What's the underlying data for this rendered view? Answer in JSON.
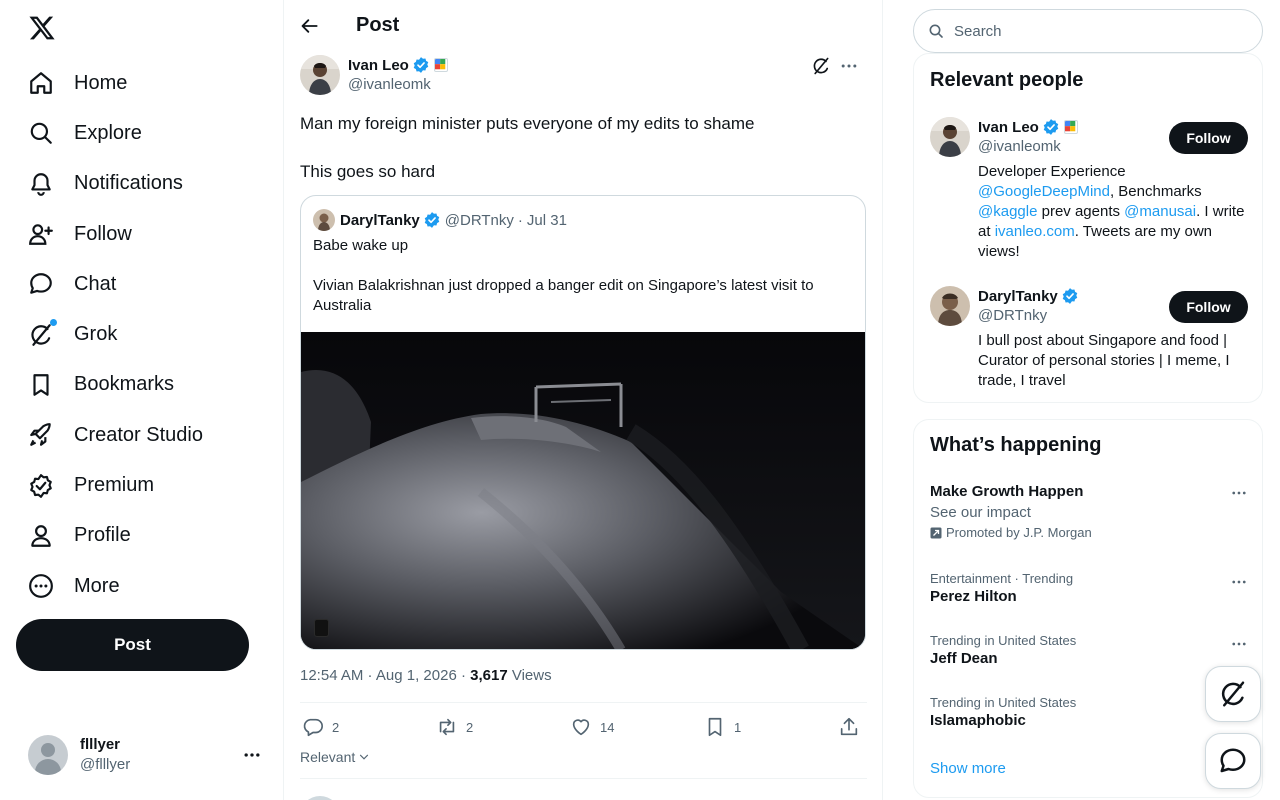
{
  "nav": {
    "items": [
      {
        "label": "Home"
      },
      {
        "label": "Explore"
      },
      {
        "label": "Notifications"
      },
      {
        "label": "Follow"
      },
      {
        "label": "Chat"
      },
      {
        "label": "Grok"
      },
      {
        "label": "Bookmarks"
      },
      {
        "label": "Creator Studio"
      },
      {
        "label": "Premium"
      },
      {
        "label": "Profile"
      },
      {
        "label": "More"
      }
    ],
    "post_label": "Post",
    "account": {
      "name": "flllyer",
      "handle": "@flllyer"
    }
  },
  "main": {
    "title": "Post",
    "post": {
      "author_name": "Ivan Leo",
      "author_handle": "@ivanleomk",
      "text_line1": "Man my foreign minister puts everyone of my edits to shame",
      "text_line2": "This goes so hard",
      "quote": {
        "author_name": "DarylTanky",
        "author_handle": "@DRTnky",
        "sep": "·",
        "date": "Jul 31",
        "text_line1": "Babe wake up",
        "text_line2": "Vivian Balakrishnan just dropped a banger edit on Singapore’s latest visit to Australia"
      },
      "timestamp": "12:54 AM · Aug 1, 2026 · ",
      "views_count": "3,617",
      "views_label": " Views",
      "replies": "2",
      "reposts": "2",
      "likes": "14",
      "bookmarks": "1"
    },
    "sort_label": "Relevant"
  },
  "sidebar": {
    "search_placeholder": "Search",
    "relevant_people": {
      "title": "Relevant people",
      "people": [
        {
          "name": "Ivan Leo",
          "handle": "@ivanleomk",
          "follow_label": "Follow",
          "bio": {
            "t1": "Developer Experience ",
            "l1": "@GoogleDeepMind",
            "t2": ", Benchmarks ",
            "l2": "@kaggle",
            "t3": " prev agents ",
            "l3": "@manusai",
            "t4": ". I write at ",
            "l4": "ivanleo.com",
            "t5": ". Tweets are my own views!"
          }
        },
        {
          "name": "DarylTanky",
          "handle": "@DRTnky",
          "follow_label": "Follow",
          "bio": "I bull post about Singapore and food | Curator of personal stories | I meme, I trade, I travel"
        }
      ]
    },
    "whats_happening": {
      "title": "What’s happening",
      "promoted": {
        "title": "Make Growth Happen",
        "subtitle": "See our impact",
        "promo_label": "Promoted by J.P. Morgan"
      },
      "trends": [
        {
          "context": "Entertainment · Trending",
          "title": "Perez Hilton"
        },
        {
          "context": "Trending in United States",
          "title": "Jeff Dean"
        },
        {
          "context": "Trending in United States",
          "title": "Islamaphobic"
        }
      ],
      "show_more": "Show more"
    }
  },
  "colors": {
    "accent": "#1d9bf0",
    "text": "#0f1419",
    "secondary": "#536471",
    "border": "#cfd9de"
  }
}
